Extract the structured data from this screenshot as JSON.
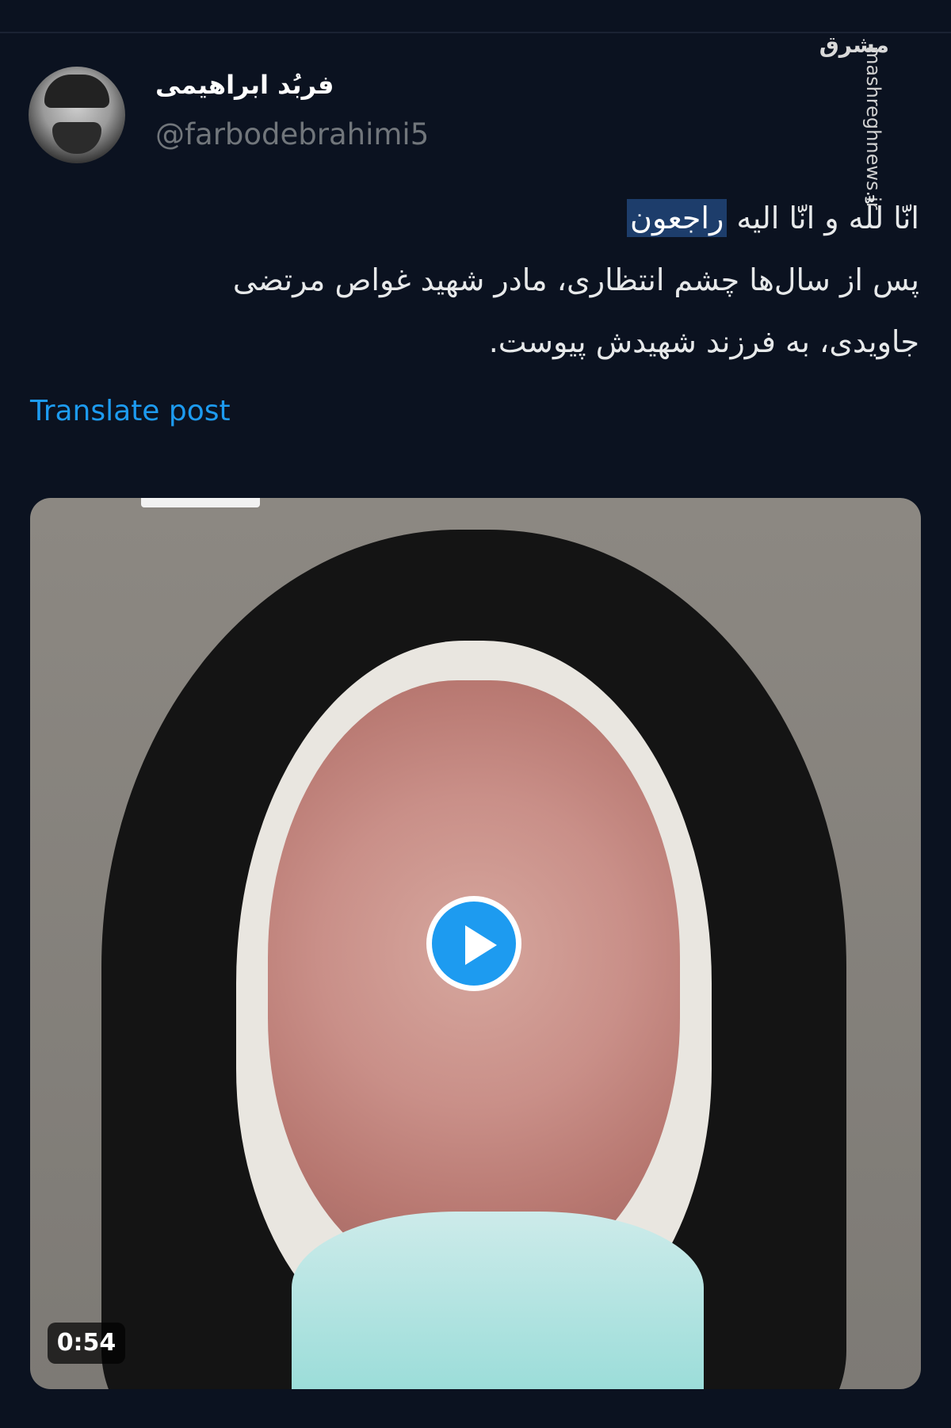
{
  "author": {
    "display_name": "فربُد ابراهیمی",
    "handle": "@farbodebrahimi5"
  },
  "watermark": {
    "logo": "مشرق",
    "url": "mashreghnews.ir"
  },
  "tweet": {
    "line1_prefix": "انّا للّه و انّا الیه ",
    "line1_highlight": "راجعون",
    "line2": "پس از سال‌ها چشم انتظاری، مادر شهید غواص مرتضی",
    "line3": "جاویدی، به فرزند شهیدش پیوست."
  },
  "translate_label": "Translate post",
  "video": {
    "duration": "0:54",
    "play_icon": "play-icon"
  },
  "colors": {
    "background": "#0b1220",
    "link": "#1d9bf0",
    "highlight": "#1d3d6b"
  }
}
